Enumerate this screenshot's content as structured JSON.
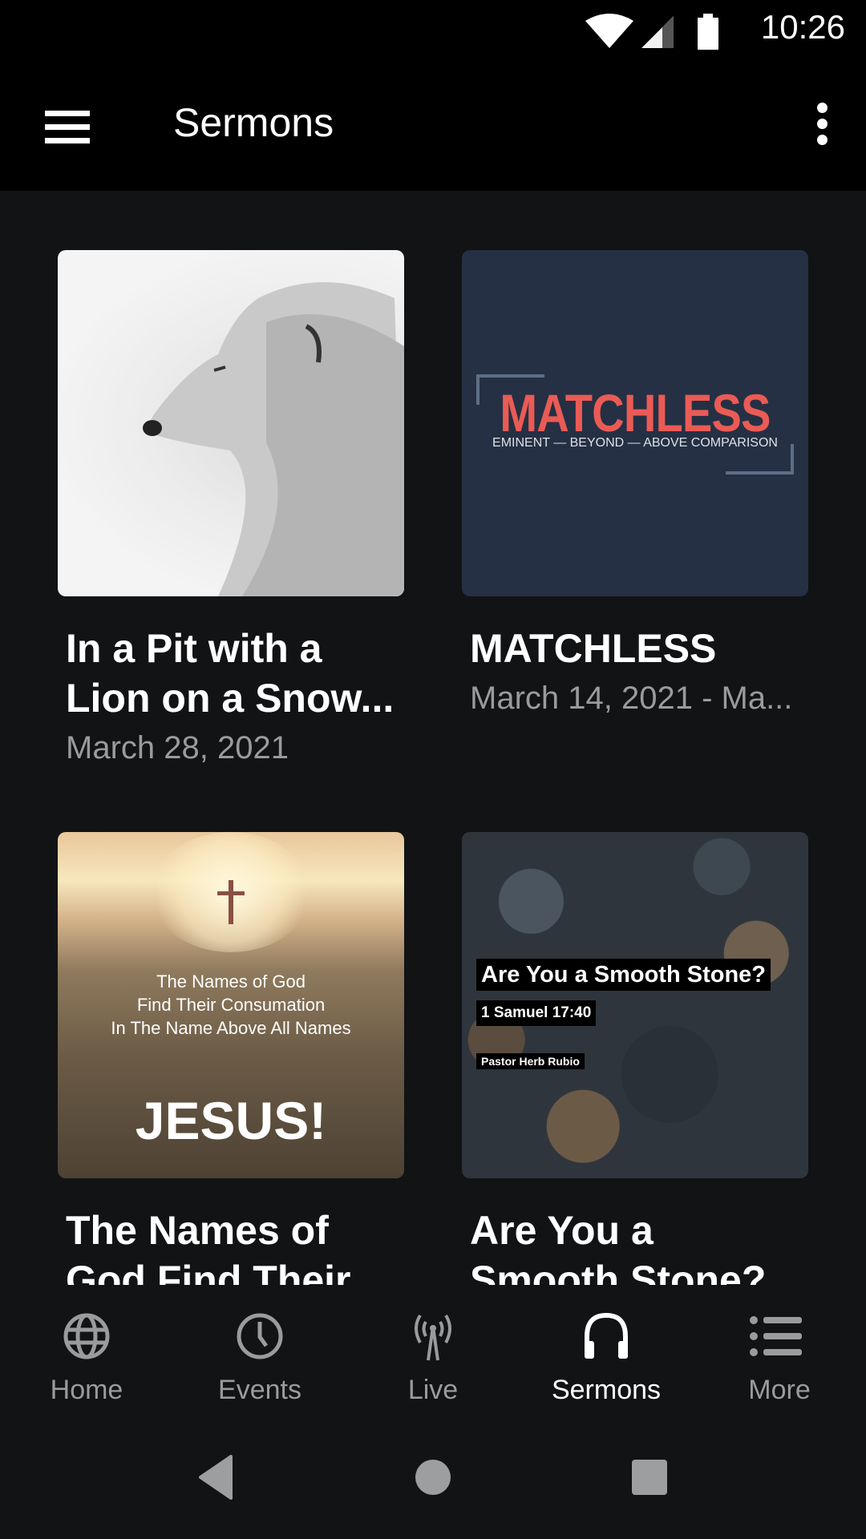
{
  "status_bar": {
    "time": "10:26",
    "icons": [
      "wifi-icon",
      "cell-signal-icon",
      "battery-icon"
    ]
  },
  "app_bar": {
    "title": "Sermons",
    "menu_icon": "hamburger-menu-icon",
    "overflow_icon": "more-vert-icon"
  },
  "sermons": [
    {
      "title": "In a Pit with a Lion on a Snow...",
      "date": "March 28, 2021",
      "thumb": "lion-photo"
    },
    {
      "title": "MATCHLESS",
      "date": "March 14, 2021 - Ma...",
      "thumb": "matchless-graphic",
      "art": {
        "heading": "MATCHLESS",
        "subheading": "EMINENT — BEYOND — ABOVE COMPARISON",
        "heading_color": "#ea5b55",
        "bg_color": "#253044"
      }
    },
    {
      "title": "The Names of God Find Their ...",
      "date": "",
      "thumb": "cross-field-photo",
      "art": {
        "line1": "The Names of God",
        "line2": "Find Their Consumation",
        "line3": "In The Name Above All Names",
        "big": "JESUS!"
      }
    },
    {
      "title": "Are You a Smooth Stone?",
      "date": "",
      "thumb": "stones-photo",
      "art": {
        "heading": "Are You a Smooth Stone?",
        "verse": "1 Samuel 17:40",
        "speaker": "Pastor Herb Rubio"
      }
    }
  ],
  "bottom_nav": [
    {
      "label": "Home",
      "icon": "globe-icon",
      "active": false
    },
    {
      "label": "Events",
      "icon": "clock-icon",
      "active": false
    },
    {
      "label": "Live",
      "icon": "broadcast-tower-icon",
      "active": false
    },
    {
      "label": "Sermons",
      "icon": "headphones-icon",
      "active": true
    },
    {
      "label": "More",
      "icon": "list-icon",
      "active": false
    }
  ],
  "system_nav": [
    "back-icon",
    "home-circle-icon",
    "recents-square-icon"
  ],
  "colors": {
    "background": "#121315",
    "bar": "#000000",
    "text_primary": "#ffffff",
    "text_secondary": "#9a9b9d"
  }
}
